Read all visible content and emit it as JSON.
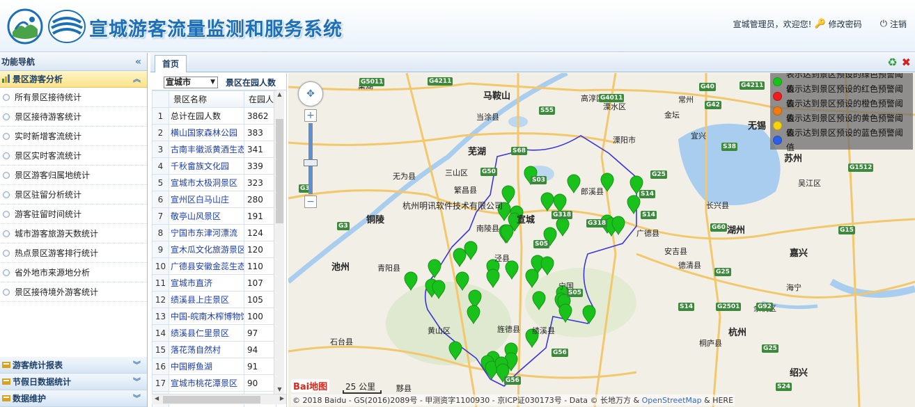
{
  "header": {
    "title": "宣城游客流量监测和服务系统",
    "welcome": "宣城管理员，欢迎您!",
    "change_password": "修改密码",
    "logout": "注销"
  },
  "sidebar": {
    "title": "功能导航",
    "active_group": "景区游客分析",
    "menu": [
      "所有景区接待统计",
      "景区接待游客统计",
      "实时新增客流统计",
      "景区实时客流统计",
      "景区游客归属地统计",
      "景区驻留分析统计",
      "游客驻留时间统计",
      "城市游客旅游天数统计",
      "热点景区游客排行统计",
      "省外地市来源地分析",
      "景区接待境外游客统计"
    ],
    "groups": [
      "游客统计报表",
      "节假日数据统计",
      "数据维护"
    ]
  },
  "tabs": [
    {
      "label": "首页"
    }
  ],
  "panel": {
    "city": "宣城市",
    "label": "景区在园人数",
    "columns": [
      "景区名称",
      "在园人数"
    ],
    "rows": [
      {
        "idx": "1",
        "name": "总计在园人数",
        "count": "3862",
        "link": false
      },
      {
        "idx": "2",
        "name": "横山国家森林公园",
        "count": "383",
        "link": true
      },
      {
        "idx": "3",
        "name": "古南丰徽派黄酒生态园",
        "count": "341",
        "link": true
      },
      {
        "idx": "4",
        "name": "千秋畲族文化园",
        "count": "339",
        "link": true
      },
      {
        "idx": "5",
        "name": "宣城市太极洞景区",
        "count": "323",
        "link": true
      },
      {
        "idx": "6",
        "name": "宣州区白马山庄",
        "count": "280",
        "link": true
      },
      {
        "idx": "7",
        "name": "敬亭山风景区",
        "count": "191",
        "link": true
      },
      {
        "idx": "8",
        "name": "宁国市东津河漂流",
        "count": "124",
        "link": true
      },
      {
        "idx": "9",
        "name": "宣木瓜文化旅游景区",
        "count": "120",
        "link": true
      },
      {
        "idx": "10",
        "name": "广德县安徽金蕊生态园",
        "count": "110",
        "link": true
      },
      {
        "idx": "11",
        "name": "宣城市直济",
        "count": "107",
        "link": true
      },
      {
        "idx": "12",
        "name": "绩溪县上庄景区",
        "count": "105",
        "link": true
      },
      {
        "idx": "13",
        "name": "中国-皖南木榨博物馆",
        "count": "100",
        "link": true
      },
      {
        "idx": "14",
        "name": "绩溪县仁里景区",
        "count": "97",
        "link": true
      },
      {
        "idx": "15",
        "name": "落花荡自然村",
        "count": "94",
        "link": true
      },
      {
        "idx": "16",
        "name": "中国孵鱼湖",
        "count": "91",
        "link": true
      },
      {
        "idx": "17",
        "name": "宣城市桃花潭景区",
        "count": "90",
        "link": true
      },
      {
        "idx": "18",
        "name": "",
        "count": "",
        "link": false
      }
    ]
  },
  "map": {
    "company": "杭州明讯软件技术有限公司",
    "legend": [
      {
        "color": "#19c21b",
        "text": "表示达到景区预设的绿色预警阈值"
      },
      {
        "color": "#ee1c1c",
        "text": "表示达到景区预设的红色预警阈值"
      },
      {
        "color": "#f07b14",
        "text": "表示达到景区预设的橙色预警阈值"
      },
      {
        "color": "#f5d40c",
        "text": "表示达到景区预设的黄色预警阈值"
      },
      {
        "color": "#2a5fe8",
        "text": "表示达到景区预设的蓝色预警阈值"
      }
    ],
    "scale": "25 公里",
    "baidu": "Bai地图",
    "copyright": "© 2018 Baidu - GS(2016)2089号 - 甲测资字1100930 - 京ICP证030173号 - Data © 长地万方 &",
    "copyright_osm": "OpenStreetMap",
    "copyright_tail": "& HERE",
    "places": [
      {
        "name": "马鞍山",
        "city": true
      },
      {
        "name": "芜湖",
        "city": true
      },
      {
        "name": "铜陵",
        "city": true
      },
      {
        "name": "池州",
        "city": true
      },
      {
        "name": "宣城",
        "city": true
      },
      {
        "name": "无锡",
        "city": true
      },
      {
        "name": "苏州",
        "city": true
      },
      {
        "name": "湖州",
        "city": true
      },
      {
        "name": "嘉兴",
        "city": true
      },
      {
        "name": "杭州",
        "city": true
      },
      {
        "name": "绍兴",
        "city": true
      },
      {
        "name": "巢湖",
        "city": false
      },
      {
        "name": "无为县",
        "city": false
      },
      {
        "name": "当涂县",
        "city": false
      },
      {
        "name": "三山区",
        "city": false
      },
      {
        "name": "繁昌县",
        "city": false
      },
      {
        "name": "南陵县",
        "city": false
      },
      {
        "name": "青阳县",
        "city": false
      },
      {
        "name": "石台县",
        "city": false
      },
      {
        "name": "黄山区",
        "city": false
      },
      {
        "name": "旌德县",
        "city": false
      },
      {
        "name": "长兴县",
        "city": false
      },
      {
        "name": "宜兴",
        "city": false
      },
      {
        "name": "溧阳市",
        "city": false
      },
      {
        "name": "溧水区",
        "city": false
      },
      {
        "name": "吴江区",
        "city": false
      },
      {
        "name": "余杭区",
        "city": false
      },
      {
        "name": "海宁",
        "city": false
      },
      {
        "name": "德清县",
        "city": false
      },
      {
        "name": "安吉县",
        "city": false
      },
      {
        "name": "桐庐县",
        "city": false
      },
      {
        "name": "黟县",
        "city": false
      },
      {
        "name": "郎溪县",
        "city": false
      },
      {
        "name": "广德县",
        "city": false
      },
      {
        "name": "泾县",
        "city": false
      },
      {
        "name": "宁国",
        "city": false
      },
      {
        "name": "绩溪县",
        "city": false
      },
      {
        "name": "高淳区",
        "city": false
      },
      {
        "name": "常州",
        "city": false
      },
      {
        "name": "金坛",
        "city": false
      }
    ],
    "roads": [
      "G5011",
      "G4211",
      "G42",
      "S55",
      "G40",
      "G4011",
      "G4211",
      "G25",
      "S38",
      "G50",
      "S68",
      "G3",
      "S03",
      "G318",
      "S05",
      "G318",
      "S14",
      "G3",
      "S14",
      "G25",
      "G60",
      "G2501",
      "G92",
      "S05",
      "G56",
      "S14",
      "G25",
      "G56",
      "S24",
      "G15",
      "G1512"
    ]
  }
}
